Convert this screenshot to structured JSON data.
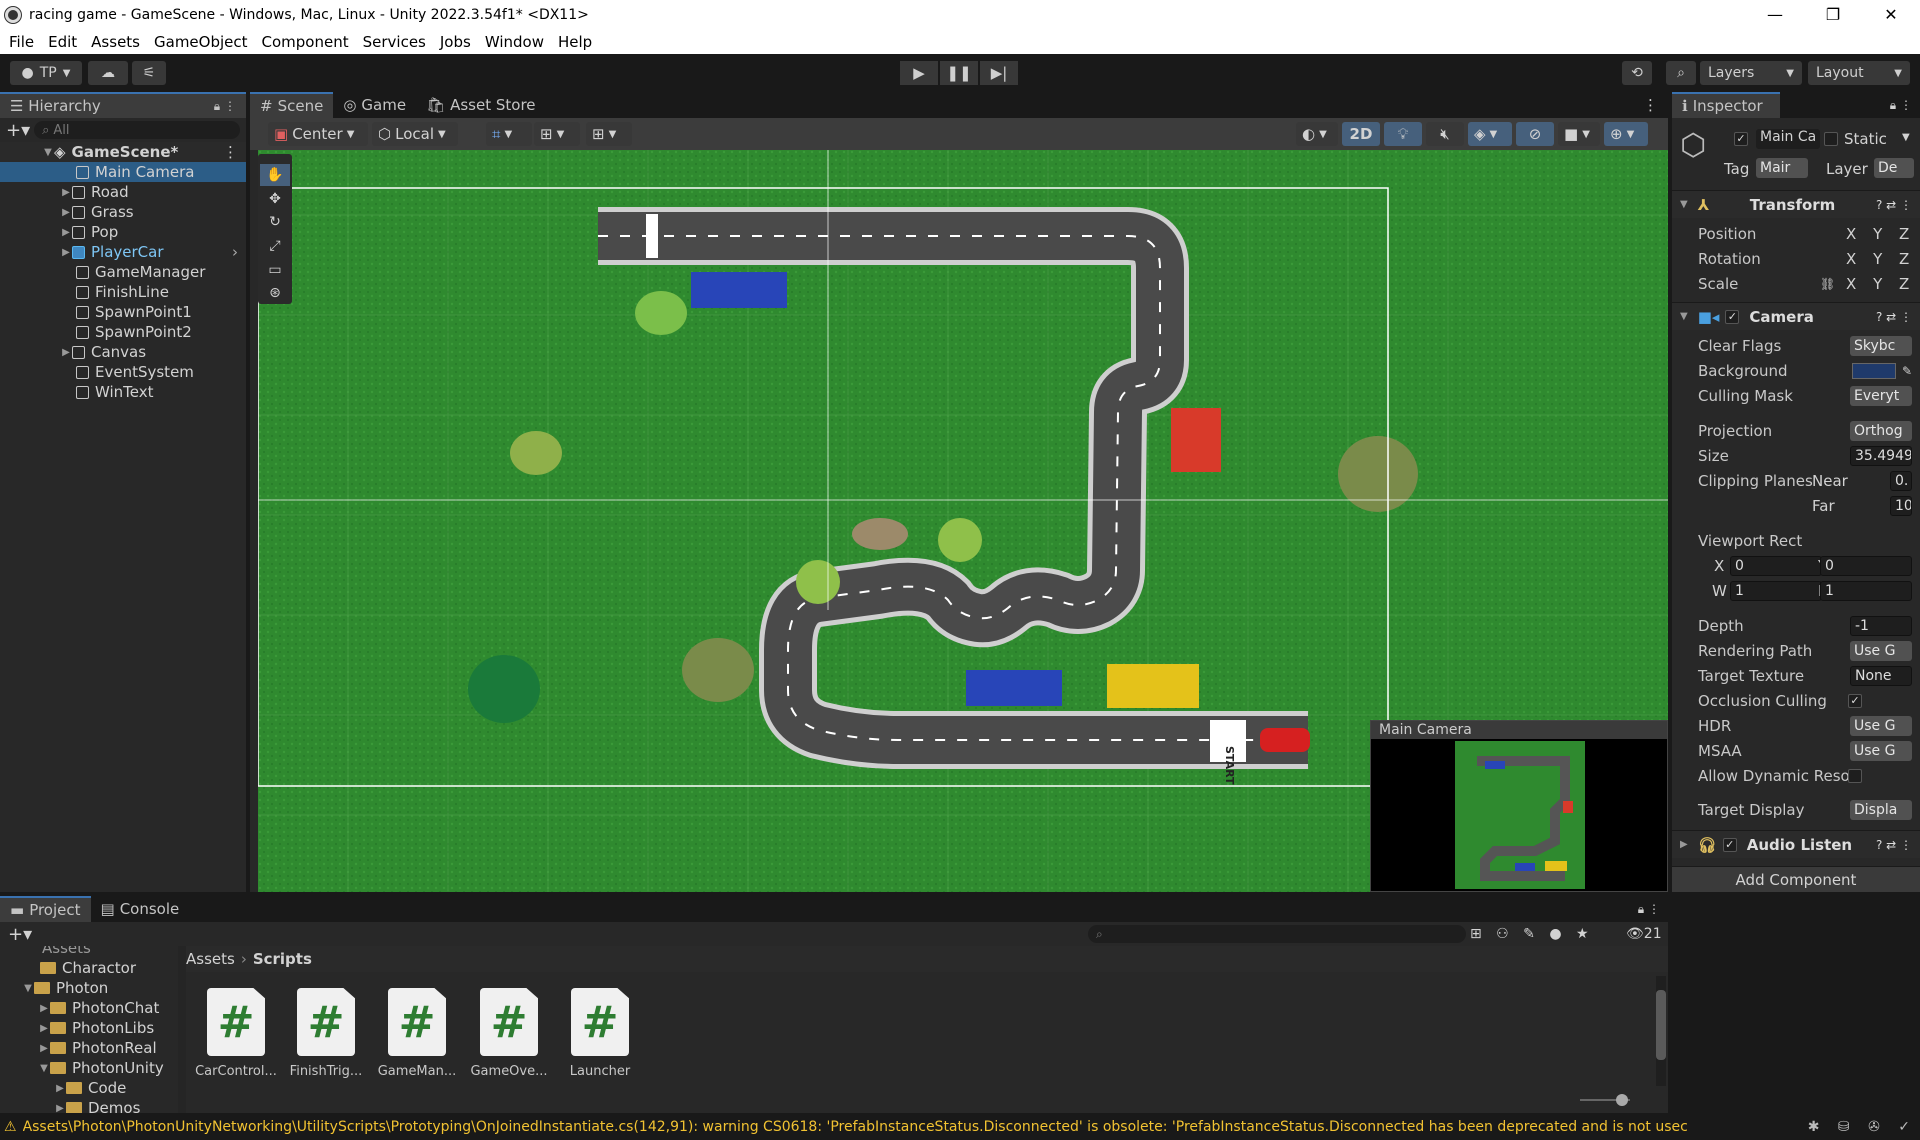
{
  "window": {
    "title": "racing game - GameScene - Windows, Mac, Linux - Unity 2022.3.54f1* <DX11>"
  },
  "menu": [
    "File",
    "Edit",
    "Assets",
    "GameObject",
    "Component",
    "Services",
    "Jobs",
    "Window",
    "Help"
  ],
  "toolbar": {
    "account": "TP",
    "layers": "Layers",
    "layout": "Layout"
  },
  "hierarchy": {
    "tab": "Hierarchy",
    "search_placeholder": "All",
    "scene": "GameScene*",
    "items": [
      {
        "label": "Main Camera",
        "selected": true,
        "expandable": false
      },
      {
        "label": "Road",
        "expandable": true
      },
      {
        "label": "Grass",
        "expandable": true
      },
      {
        "label": "Pop",
        "expandable": true
      },
      {
        "label": "PlayerCar",
        "expandable": true,
        "prefab": true
      },
      {
        "label": "GameManager",
        "expandable": false
      },
      {
        "label": "FinishLine",
        "expandable": false
      },
      {
        "label": "SpawnPoint1",
        "expandable": false
      },
      {
        "label": "SpawnPoint2",
        "expandable": false
      },
      {
        "label": "Canvas",
        "expandable": true
      },
      {
        "label": "EventSystem",
        "expandable": false
      },
      {
        "label": "WinText",
        "expandable": false
      }
    ]
  },
  "scene": {
    "tabs": [
      "Scene",
      "Game",
      "Asset Store"
    ],
    "pivot": "Center",
    "space": "Local",
    "mode_2d": "2D",
    "camera_preview_title": "Main Camera",
    "start_text": "START"
  },
  "inspector": {
    "tab": "Inspector",
    "object_name": "Main Ca",
    "static_label": "Static",
    "tag_label": "Tag",
    "tag_value": "Mair",
    "layer_label": "Layer",
    "layer_value": "De",
    "transform": {
      "title": "Transform",
      "rows": [
        "Position",
        "Rotation",
        "Scale"
      ],
      "axes": [
        "X",
        "Y",
        "Z"
      ]
    },
    "camera": {
      "title": "Camera",
      "clear_flags": {
        "label": "Clear Flags",
        "value": "Skybc"
      },
      "background": {
        "label": "Background",
        "color": "#1f3a6b"
      },
      "culling_mask": {
        "label": "Culling Mask",
        "value": "Everyt"
      },
      "projection": {
        "label": "Projection",
        "value": "Orthog"
      },
      "size": {
        "label": "Size",
        "value": "35.4949"
      },
      "clipping": {
        "label": "Clipping Planes",
        "near_label": "Near",
        "near": "0.",
        "far_label": "Far",
        "far": "10"
      },
      "viewport": {
        "label": "Viewport Rect",
        "x": "0",
        "y": "0",
        "w": "1",
        "h": "1"
      },
      "depth": {
        "label": "Depth",
        "value": "-1"
      },
      "rendering_path": {
        "label": "Rendering Path",
        "value": "Use G"
      },
      "target_texture": {
        "label": "Target Texture",
        "value": "None"
      },
      "occlusion_culling": {
        "label": "Occlusion Culling",
        "checked": true
      },
      "hdr": {
        "label": "HDR",
        "value": "Use G"
      },
      "msaa": {
        "label": "MSAA",
        "value": "Use G"
      },
      "allow_dynamic": {
        "label": "Allow Dynamic Reso"
      },
      "target_display": {
        "label": "Target Display",
        "value": "Displa"
      }
    },
    "audio": {
      "title": "Audio Listen"
    },
    "add_component": "Add Component"
  },
  "project": {
    "tabs": [
      "Project",
      "Console"
    ],
    "tree": [
      {
        "label": "Assets",
        "indent": 0,
        "partial": true
      },
      {
        "label": "Charactor",
        "indent": 1
      },
      {
        "label": "Photon",
        "indent": 1,
        "open": true
      },
      {
        "label": "PhotonChat",
        "indent": 2
      },
      {
        "label": "PhotonLibs",
        "indent": 2
      },
      {
        "label": "PhotonReal",
        "indent": 2
      },
      {
        "label": "PhotonUnity",
        "indent": 2,
        "open": true
      },
      {
        "label": "Code",
        "indent": 3
      },
      {
        "label": "Demos",
        "indent": 3
      }
    ],
    "breadcrumb": [
      "Assets",
      "Scripts"
    ],
    "files": [
      "CarControl...",
      "FinishTrig...",
      "GameMan...",
      "GameOve...",
      "Launcher"
    ],
    "hidden_count": "21"
  },
  "status": {
    "message": "Assets\\Photon\\PhotonUnityNetworking\\UtilityScripts\\Prototyping\\OnJoinedInstantiate.cs(142,91): warning CS0618: 'PrefabInstanceStatus.Disconnected' is obsolete: 'PrefabInstanceStatus.Disconnected has been deprecated and is not usec"
  },
  "colors": {
    "accent": "#2c5d87",
    "grass": "#2f8a2f",
    "road": "#4a4a4a",
    "warning": "#f1c232"
  }
}
